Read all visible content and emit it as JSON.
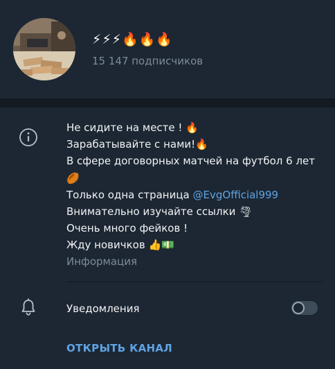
{
  "channel": {
    "title": "⚡⚡⚡🔥🔥🔥",
    "subscribers": "15 147 подписчиков"
  },
  "description": {
    "line1": "Не сидите на месте ! 🔥",
    "line2": "Зарабатывайте с нами!🔥",
    "line3": "В сфере договорных матчей на футбол 6 лет",
    "line4": "🏉",
    "line5_prefix": "Только одна страница ",
    "line5_link": "@EvgOfficial999",
    "line6": "Внимательно изучайте ссылки 🌪",
    "line7": "Очень много фейков !",
    "line8": "Жду новичков 👍💵",
    "label": "Информация"
  },
  "notifications": {
    "label": "Уведомления",
    "enabled": false
  },
  "actions": {
    "open_channel": "ОТКРЫТЬ КАНАЛ"
  },
  "colors": {
    "background": "#1c2733",
    "separator": "#131a22",
    "accent": "#5fa3e3",
    "secondary_text": "#7f8b97"
  },
  "icons": {
    "info": "info-circle-icon",
    "notifications": "bell-icon"
  }
}
